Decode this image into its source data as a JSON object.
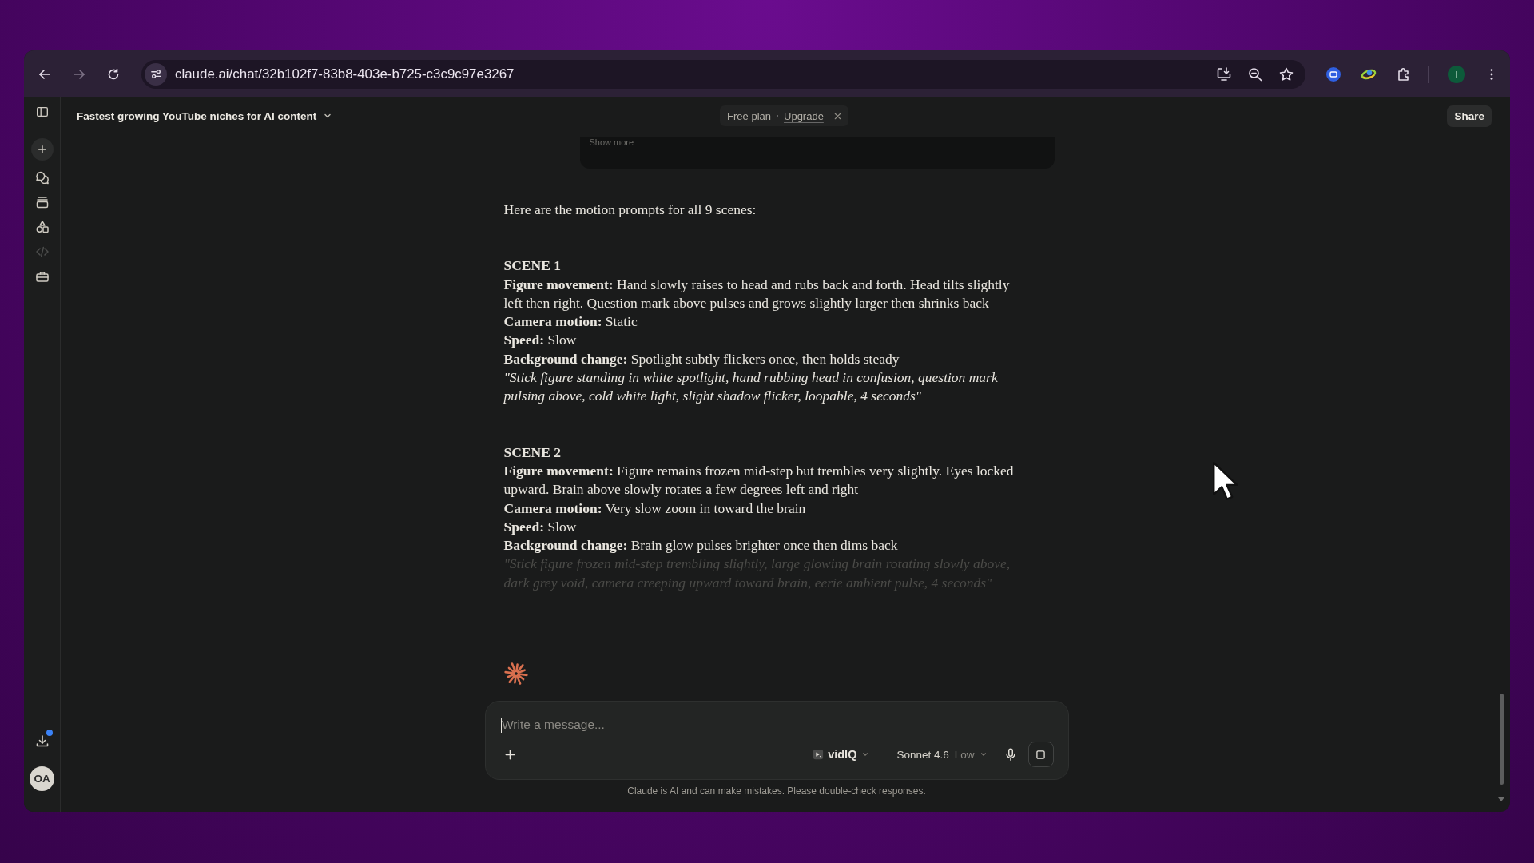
{
  "browser": {
    "nav_buttons": [
      {
        "kind": "back",
        "disabled": false
      },
      {
        "kind": "forward",
        "disabled": true
      },
      {
        "kind": "reload",
        "disabled": false
      }
    ],
    "url": "claude.ai/chat/32b102f7-83b8-403e-b725-c3c9c97e3267",
    "profile_initial": "I"
  },
  "sidebar": {
    "items": [
      {
        "kind": "panel",
        "disabled": false
      },
      {
        "kind": "new",
        "disabled": false
      },
      {
        "kind": "chats",
        "disabled": false
      },
      {
        "kind": "projects",
        "disabled": false
      },
      {
        "kind": "artifacts",
        "disabled": false
      },
      {
        "kind": "code",
        "disabled": true
      },
      {
        "kind": "briefcase",
        "disabled": false
      }
    ],
    "download_badge": true,
    "avatar": "OA"
  },
  "header": {
    "title": "Fastest growing YouTube niches for AI content",
    "plan": "Free plan",
    "upgrade": "Upgrade",
    "share": "Share"
  },
  "conversation": {
    "show_more": "Show more",
    "intro": "Here are the motion prompts for all 9 scenes:",
    "scenes": [
      {
        "title": "SCENE 1",
        "lines": [
          "**Figure movement:** Hand slowly raises to head and rubs back and forth. Head tilts slightly left then right. Question mark above pulses and grows slightly larger then shrinks back",
          "**Camera motion:** Static",
          "**Speed:** Slow",
          "**Background change:** Spotlight subtly flickers once, then holds steady"
        ],
        "prompt": "\"Stick figure standing in white spotlight, hand rubbing head in confusion, question mark pulsing above, cold white light, slight shadow flicker, loopable, 4 seconds\"",
        "prompt_faded": false
      },
      {
        "title": "SCENE 2",
        "lines": [
          "**Figure movement:** Figure remains frozen mid-step but trembles very slightly. Eyes locked upward. Brain above slowly rotates a few degrees left and right",
          "**Camera motion:** Very slow zoom in toward the brain",
          "**Speed:** Slow",
          "**Background change:** Brain glow pulses brighter once then dims back"
        ],
        "prompt": "\"Stick figure frozen mid-step trembling slightly, large glowing brain rotating slowly above, dark grey void, camera creeping upward toward brain, eerie ambient pulse, 4 seconds\"",
        "prompt_faded": true
      }
    ]
  },
  "composer": {
    "placeholder": "Write a message...",
    "tool": "vidIQ",
    "model": "Sonnet 4.6",
    "effort": "Low"
  },
  "disclaimer": "Claude is AI and can make mistakes. Please double-check responses."
}
